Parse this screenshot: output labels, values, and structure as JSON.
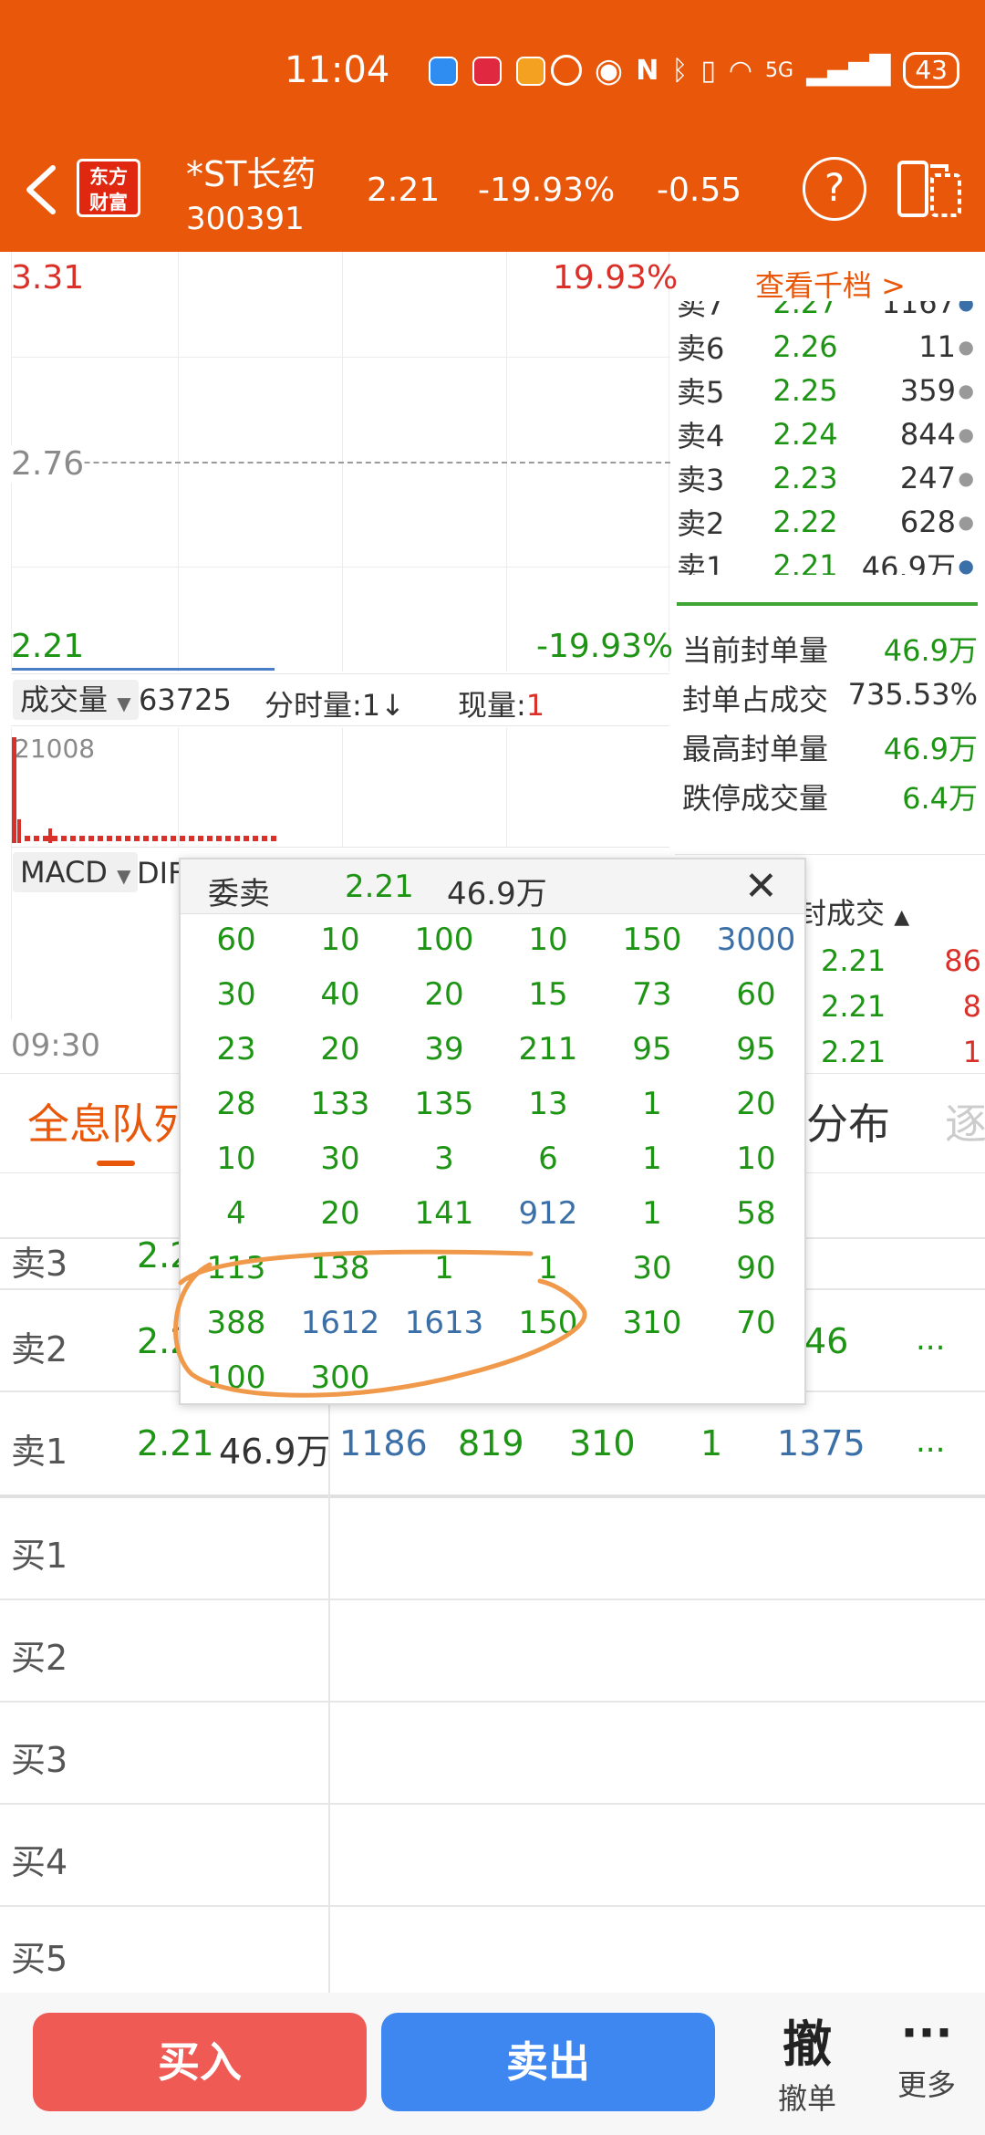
{
  "status_bar": {
    "time": "11:04",
    "battery": "43",
    "network": "5G"
  },
  "header": {
    "logo_line1": "东方",
    "logo_line2": "财富",
    "name": "*ST长药",
    "code": "300391",
    "price": "2.21",
    "pct": "-19.93%",
    "change": "-0.55",
    "help": "?"
  },
  "chart": {
    "high_price": "3.31",
    "high_pct": "19.93%",
    "mid_price": "2.76",
    "low_price": "2.21",
    "low_pct": "-19.93%",
    "time_start": "09:30"
  },
  "volume_bar": {
    "selector": "成交量",
    "value": "63725",
    "fenshi_label": "分时量:1",
    "fenshi_arrow": "↓",
    "xianliang_label": "现量:",
    "xianliang_value": "1",
    "vol_max": "21008"
  },
  "macd": {
    "selector": "MACD",
    "label": "DIF"
  },
  "orderbook": {
    "view_all": "查看千档 >",
    "rows": [
      {
        "label": "卖7",
        "price": "2.27",
        "vol": "1167"
      },
      {
        "label": "卖6",
        "price": "2.26",
        "vol": "11"
      },
      {
        "label": "卖5",
        "price": "2.25",
        "vol": "359"
      },
      {
        "label": "卖4",
        "price": "2.24",
        "vol": "844"
      },
      {
        "label": "卖3",
        "price": "2.23",
        "vol": "247"
      },
      {
        "label": "卖2",
        "price": "2.22",
        "vol": "628"
      },
      {
        "label": "卖1",
        "price": "2.21",
        "vol": "46.9万"
      }
    ]
  },
  "stats": [
    {
      "label": "当前封单量",
      "value": "46.9万"
    },
    {
      "label": "封单占成交",
      "value": "735.53%"
    },
    {
      "label": "最高封单量",
      "value": "46.9万"
    },
    {
      "label": "跌停成交量",
      "value": "6.4万"
    }
  ],
  "trades": {
    "header": "封成交",
    "rows": [
      {
        "price": "2.21",
        "vol": "86"
      },
      {
        "price": "2.21",
        "vol": "8"
      },
      {
        "price": "2.21",
        "vol": "1"
      }
    ]
  },
  "tabs": {
    "tab1": "全息队列",
    "tab2": "分布",
    "tab3": "逐"
  },
  "queue": {
    "sell3": {
      "label": "卖3",
      "price": "2.2"
    },
    "sell2": {
      "label": "卖2",
      "price": "2.2",
      "v": "46",
      "more": "..."
    },
    "sell1": {
      "label": "卖1",
      "price": "2.21",
      "total": "46.9万",
      "q": [
        "1186",
        "819",
        "310",
        "1",
        "1375"
      ],
      "more": "..."
    },
    "buy": [
      "买1",
      "买2",
      "买3",
      "买4",
      "买5"
    ]
  },
  "popup": {
    "title": "委卖",
    "price": "2.21",
    "total": "46.9万",
    "close": "✕",
    "rows": [
      [
        "60",
        "10",
        "100",
        "10",
        "150",
        "3000"
      ],
      [
        "30",
        "40",
        "20",
        "15",
        "73",
        "60"
      ],
      [
        "23",
        "20",
        "39",
        "211",
        "95",
        "95"
      ],
      [
        "28",
        "133",
        "135",
        "13",
        "1",
        "20"
      ],
      [
        "10",
        "30",
        "3",
        "6",
        "1",
        "10"
      ],
      [
        "4",
        "20",
        "141",
        "912",
        "1",
        "58"
      ],
      [
        "113",
        "138",
        "1",
        "1",
        "30",
        "90"
      ],
      [
        "388",
        "1612",
        "1613",
        "150",
        "310",
        "70"
      ],
      [
        "100",
        "300"
      ]
    ],
    "blue_cells": [
      "3000",
      "912",
      "1612",
      "1613"
    ]
  },
  "bottom_bar": {
    "buy": "买入",
    "sell": "卖出",
    "cancel_icon": "撤",
    "cancel": "撤单",
    "more_icon": "···",
    "more": "更多"
  },
  "colors": {
    "brand": "#E8570A",
    "up": "#D9302A",
    "down": "#1E9414",
    "blue": "#3B6FA8",
    "buy_btn": "#EF5A55",
    "sell_btn": "#3E86F0"
  }
}
